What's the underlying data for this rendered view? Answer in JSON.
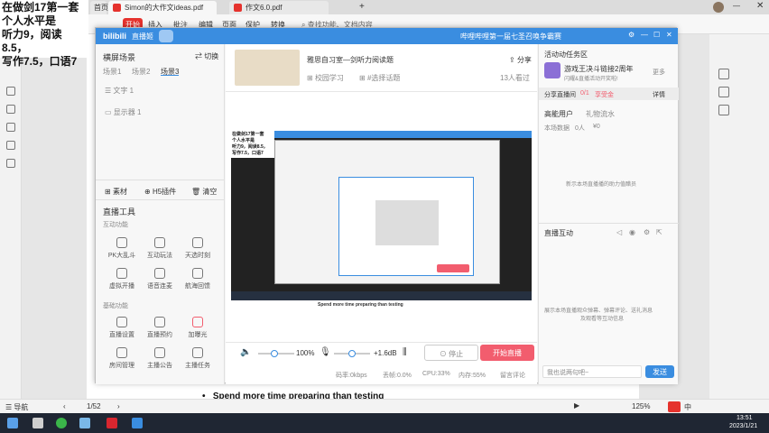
{
  "overlay_text": [
    "在做剑17第一套",
    "个人水平是",
    "听力9，阅读8.5，",
    "写作7.5，口语7"
  ],
  "pdf_tabs": [
    {
      "label": "首页"
    },
    {
      "label": "Simon的大作文ideas.pdf"
    },
    {
      "label": "作文6.0.pdf"
    }
  ],
  "pdf_menu": {
    "start": "开始",
    "items": [
      "插入",
      "批注",
      "编辑",
      "页面",
      "保护",
      "转换"
    ],
    "search": "查找功能、文档内容"
  },
  "doc_text": "Spend more time preparing than testing",
  "statusbar": {
    "nav": "导航",
    "page": "1/52",
    "zoom": "125%"
  },
  "taskbar": {
    "time": "13:51",
    "date": "2023/1/21",
    "lang": "中"
  },
  "studio": {
    "brand": "直播姬",
    "marquee": "哔哩哔哩第一届七圣召唤争霸赛",
    "left": {
      "scene_title": "横屏场景",
      "switch": "切换",
      "scenes": [
        "场景1",
        "场景2",
        "场景3"
      ],
      "sources": [
        "文字 1",
        "显示器 1"
      ],
      "source_actions": [
        "素材",
        "H5插件",
        "清空"
      ],
      "tools_title": "直播工具",
      "interactive_title": "互动功能",
      "interactive_tools": [
        "PK大乱斗",
        "互动玩法",
        "天选时刻",
        "虚拟开播",
        "语音连麦",
        "航海回馈"
      ],
      "basic_title": "基础功能",
      "basic_tools": [
        "直播设置",
        "直播预约",
        "加曝光",
        "房间管理",
        "主播公告",
        "主播任务"
      ]
    },
    "center": {
      "room_title": "雅思自习室—剑听力阅读题",
      "category": "校园学习",
      "tag": "#选择话题",
      "share": "分享",
      "viewers": "13人看过",
      "preview_title": "Spend more time preparing than testing",
      "volume1": "100%",
      "volume2": "+1.6dB",
      "stop": "停止",
      "start": "开始直播",
      "stats": [
        "码率:0kbps",
        "丢帧:0.0%",
        "CPU:33%",
        "内存:55%",
        "留言评论"
      ]
    },
    "right": {
      "activity_title": "活动动任务区",
      "promo_title": "游戏王决斗链接2周年",
      "promo_sub": "闪耀&直播活动开奖啦!",
      "more": "更多",
      "task_title": "分享直播间",
      "task_progress": "0/1",
      "task_reward": "享受金",
      "task_detail": "详情",
      "high_energy": "高能用户",
      "gift_flow": "礼物流水",
      "stats_label": "本场数据",
      "stats_vals": [
        "0人",
        "¥0"
      ],
      "empty_high": "新示本场直播播的助力值醋员",
      "interact_title": "直播互动",
      "interact_hint1": "展示本场直播观众弹幕、弹幕评论、送礼消息",
      "interact_hint2": "及观看等互动信息",
      "input_placeholder": "我也说两句吧~",
      "send": "发送"
    }
  },
  "colors": {
    "accent": "#3a8de0",
    "start_btn": "#f25d6e",
    "pdf_red": "#e5322d"
  }
}
